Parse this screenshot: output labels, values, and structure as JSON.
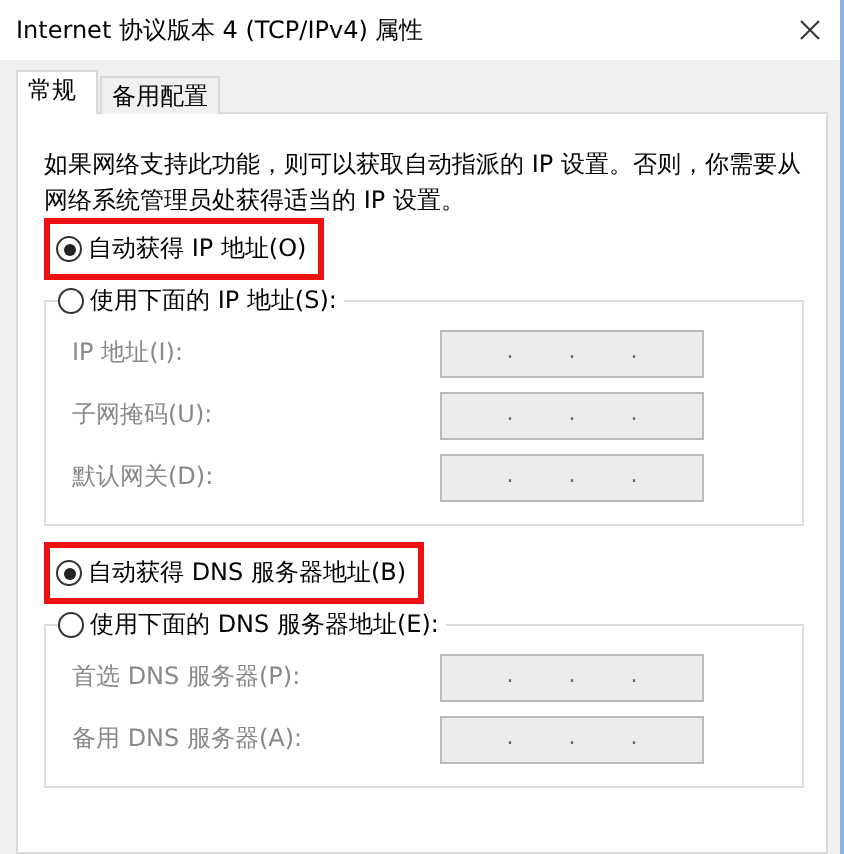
{
  "window": {
    "title": "Internet 协议版本 4 (TCP/IPv4) 属性"
  },
  "tabs": [
    {
      "label": "常规",
      "selected": true
    },
    {
      "label": "备用配置",
      "selected": false
    }
  ],
  "description": "如果网络支持此功能，则可以获取自动指派的 IP 设置。否则，你需要从网络系统管理员处获得适当的 IP 设置。",
  "sections": [
    {
      "options": [
        {
          "label": "自动获得 IP 地址(O)",
          "selected": true,
          "highlighted": true
        },
        {
          "label": "使用下面的 IP 地址(S):",
          "selected": false,
          "highlighted": false
        }
      ],
      "fields": [
        {
          "label": "IP 地址(I):",
          "value": ". . .",
          "disabled": true
        },
        {
          "label": "子网掩码(U):",
          "value": ". . .",
          "disabled": true
        },
        {
          "label": "默认网关(D):",
          "value": ". . .",
          "disabled": true
        }
      ]
    },
    {
      "options": [
        {
          "label": "自动获得 DNS 服务器地址(B)",
          "selected": true,
          "highlighted": true
        },
        {
          "label": "使用下面的 DNS 服务器地址(E):",
          "selected": false,
          "highlighted": false
        }
      ],
      "fields": [
        {
          "label": "首选 DNS 服务器(P):",
          "value": ". . .",
          "disabled": true
        },
        {
          "label": "备用 DNS 服务器(A):",
          "value": ". . .",
          "disabled": true
        }
      ]
    }
  ]
}
